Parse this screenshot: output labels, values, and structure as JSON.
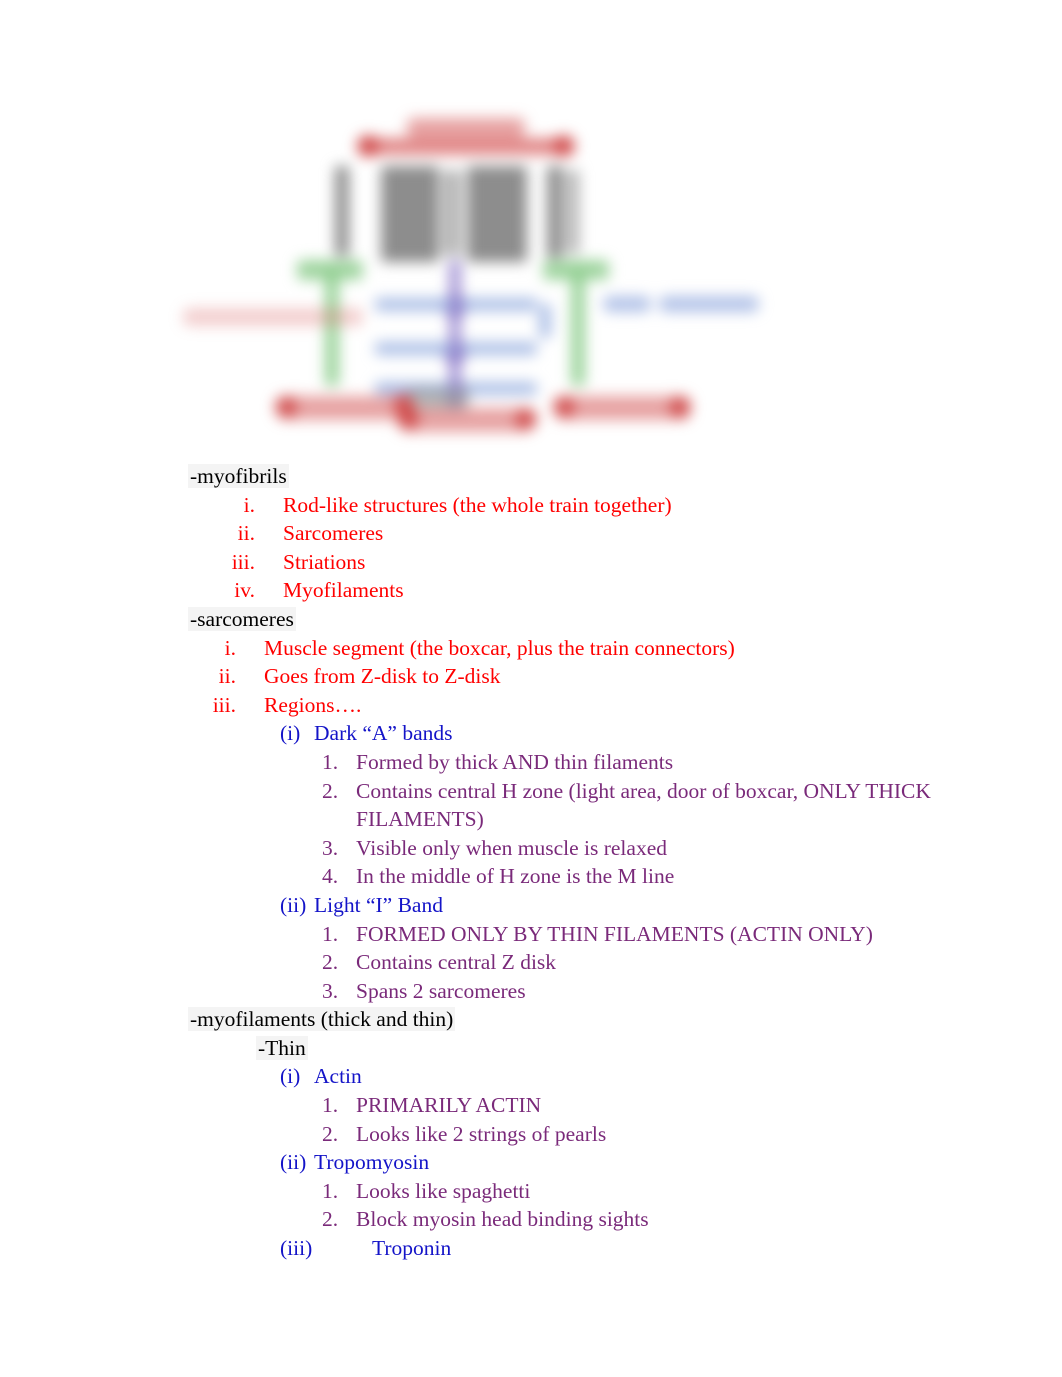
{
  "document": {
    "figure": {
      "caption_alt": "Blurred sarcomere structure diagram",
      "colors": {
        "label_red": "#d96a6a",
        "label_blue": "#93a9de",
        "z_disk_green": "#8fce8f",
        "thin_filament_blue": "#9db4e2",
        "m_line_purple": "#9b8bd0",
        "thick_filament_gray": "#7d7d7d"
      }
    },
    "colors": {
      "heading": "#000000",
      "level_roman": "#ff0000",
      "level_paren": "#1414c8",
      "level_number": "#7a2a7a"
    },
    "outline": [
      {
        "id": "myofibrils",
        "heading": "-myofibrils",
        "items": [
          {
            "num": "i.",
            "text": "Rod-like structures (the whole train together)"
          },
          {
            "num": "ii.",
            "text": "Sarcomeres"
          },
          {
            "num": "iii.",
            "text": "Striations"
          },
          {
            "num": "iv.",
            "text": "Myofilaments"
          }
        ]
      },
      {
        "id": "sarcomeres",
        "heading": "-sarcomeres",
        "items": [
          {
            "num": "i.",
            "text": "Muscle segment (the boxcar, plus the train connectors)"
          },
          {
            "num": "ii.",
            "text": "Goes from Z-disk to Z-disk"
          },
          {
            "num": "iii.",
            "text": "Regions…."
          }
        ],
        "subgroups": [
          {
            "num": "(i)",
            "text": "Dark “A” bands",
            "points": [
              {
                "num": "1.",
                "text": "Formed by thick AND thin filaments"
              },
              {
                "num": "2.",
                "text": "Contains central H zone (light area, door of boxcar, ONLY THICK FILAMENTS)"
              },
              {
                "num": "3.",
                "text": "Visible only when muscle is relaxed"
              },
              {
                "num": "4.",
                "text": "In the middle of H zone is the M line"
              }
            ]
          },
          {
            "num": "(ii)",
            "text": "Light “I” Band",
            "points": [
              {
                "num": "1.",
                "text": "FORMED ONLY BY THIN FILAMENTS (ACTIN ONLY)"
              },
              {
                "num": "2.",
                "text": "Contains central Z disk"
              },
              {
                "num": "3.",
                "text": "Spans 2 sarcomeres"
              }
            ]
          }
        ]
      },
      {
        "id": "myofilaments",
        "heading": "-myofilaments (thick and thin)",
        "subheading": "-Thin",
        "subgroups": [
          {
            "num": "(i)",
            "text": "Actin",
            "points": [
              {
                "num": "1.",
                "text": "PRIMARILY ACTIN"
              },
              {
                "num": "2.",
                "text": "Looks like 2 strings of pearls"
              }
            ]
          },
          {
            "num": "(ii)",
            "text": "Tropomyosin",
            "points": [
              {
                "num": "1.",
                "text": "Looks like spaghetti"
              },
              {
                "num": "2.",
                "text": "Block myosin head binding sights"
              }
            ]
          },
          {
            "num": "(iii)",
            "text": "Troponin",
            "wide_gap": true,
            "points": []
          }
        ]
      }
    ]
  }
}
